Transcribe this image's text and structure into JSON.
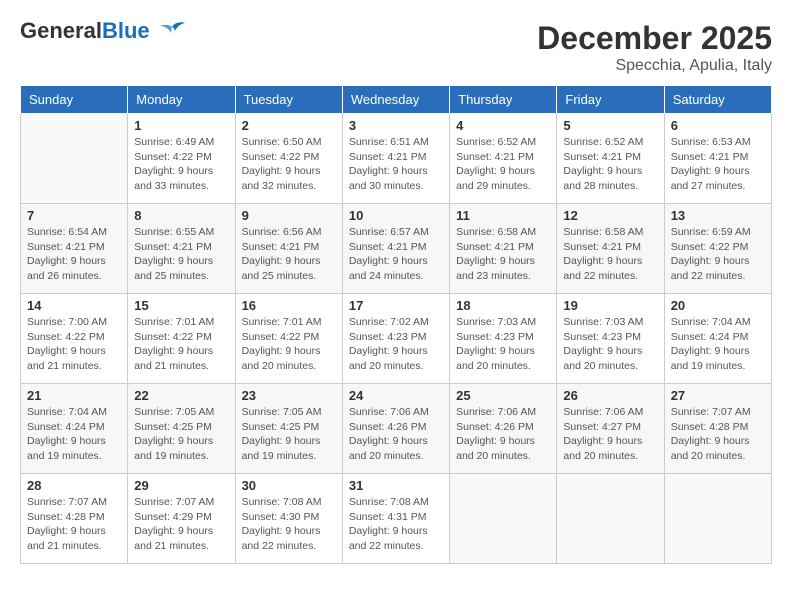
{
  "header": {
    "logo_general": "General",
    "logo_blue": "Blue",
    "month": "December 2025",
    "location": "Specchia, Apulia, Italy"
  },
  "weekdays": [
    "Sunday",
    "Monday",
    "Tuesday",
    "Wednesday",
    "Thursday",
    "Friday",
    "Saturday"
  ],
  "weeks": [
    [
      {
        "day": "",
        "info": ""
      },
      {
        "day": "1",
        "info": "Sunrise: 6:49 AM\nSunset: 4:22 PM\nDaylight: 9 hours\nand 33 minutes."
      },
      {
        "day": "2",
        "info": "Sunrise: 6:50 AM\nSunset: 4:22 PM\nDaylight: 9 hours\nand 32 minutes."
      },
      {
        "day": "3",
        "info": "Sunrise: 6:51 AM\nSunset: 4:21 PM\nDaylight: 9 hours\nand 30 minutes."
      },
      {
        "day": "4",
        "info": "Sunrise: 6:52 AM\nSunset: 4:21 PM\nDaylight: 9 hours\nand 29 minutes."
      },
      {
        "day": "5",
        "info": "Sunrise: 6:52 AM\nSunset: 4:21 PM\nDaylight: 9 hours\nand 28 minutes."
      },
      {
        "day": "6",
        "info": "Sunrise: 6:53 AM\nSunset: 4:21 PM\nDaylight: 9 hours\nand 27 minutes."
      }
    ],
    [
      {
        "day": "7",
        "info": "Sunrise: 6:54 AM\nSunset: 4:21 PM\nDaylight: 9 hours\nand 26 minutes."
      },
      {
        "day": "8",
        "info": "Sunrise: 6:55 AM\nSunset: 4:21 PM\nDaylight: 9 hours\nand 25 minutes."
      },
      {
        "day": "9",
        "info": "Sunrise: 6:56 AM\nSunset: 4:21 PM\nDaylight: 9 hours\nand 25 minutes."
      },
      {
        "day": "10",
        "info": "Sunrise: 6:57 AM\nSunset: 4:21 PM\nDaylight: 9 hours\nand 24 minutes."
      },
      {
        "day": "11",
        "info": "Sunrise: 6:58 AM\nSunset: 4:21 PM\nDaylight: 9 hours\nand 23 minutes."
      },
      {
        "day": "12",
        "info": "Sunrise: 6:58 AM\nSunset: 4:21 PM\nDaylight: 9 hours\nand 22 minutes."
      },
      {
        "day": "13",
        "info": "Sunrise: 6:59 AM\nSunset: 4:22 PM\nDaylight: 9 hours\nand 22 minutes."
      }
    ],
    [
      {
        "day": "14",
        "info": "Sunrise: 7:00 AM\nSunset: 4:22 PM\nDaylight: 9 hours\nand 21 minutes."
      },
      {
        "day": "15",
        "info": "Sunrise: 7:01 AM\nSunset: 4:22 PM\nDaylight: 9 hours\nand 21 minutes."
      },
      {
        "day": "16",
        "info": "Sunrise: 7:01 AM\nSunset: 4:22 PM\nDaylight: 9 hours\nand 20 minutes."
      },
      {
        "day": "17",
        "info": "Sunrise: 7:02 AM\nSunset: 4:23 PM\nDaylight: 9 hours\nand 20 minutes."
      },
      {
        "day": "18",
        "info": "Sunrise: 7:03 AM\nSunset: 4:23 PM\nDaylight: 9 hours\nand 20 minutes."
      },
      {
        "day": "19",
        "info": "Sunrise: 7:03 AM\nSunset: 4:23 PM\nDaylight: 9 hours\nand 20 minutes."
      },
      {
        "day": "20",
        "info": "Sunrise: 7:04 AM\nSunset: 4:24 PM\nDaylight: 9 hours\nand 19 minutes."
      }
    ],
    [
      {
        "day": "21",
        "info": "Sunrise: 7:04 AM\nSunset: 4:24 PM\nDaylight: 9 hours\nand 19 minutes."
      },
      {
        "day": "22",
        "info": "Sunrise: 7:05 AM\nSunset: 4:25 PM\nDaylight: 9 hours\nand 19 minutes."
      },
      {
        "day": "23",
        "info": "Sunrise: 7:05 AM\nSunset: 4:25 PM\nDaylight: 9 hours\nand 19 minutes."
      },
      {
        "day": "24",
        "info": "Sunrise: 7:06 AM\nSunset: 4:26 PM\nDaylight: 9 hours\nand 20 minutes."
      },
      {
        "day": "25",
        "info": "Sunrise: 7:06 AM\nSunset: 4:26 PM\nDaylight: 9 hours\nand 20 minutes."
      },
      {
        "day": "26",
        "info": "Sunrise: 7:06 AM\nSunset: 4:27 PM\nDaylight: 9 hours\nand 20 minutes."
      },
      {
        "day": "27",
        "info": "Sunrise: 7:07 AM\nSunset: 4:28 PM\nDaylight: 9 hours\nand 20 minutes."
      }
    ],
    [
      {
        "day": "28",
        "info": "Sunrise: 7:07 AM\nSunset: 4:28 PM\nDaylight: 9 hours\nand 21 minutes."
      },
      {
        "day": "29",
        "info": "Sunrise: 7:07 AM\nSunset: 4:29 PM\nDaylight: 9 hours\nand 21 minutes."
      },
      {
        "day": "30",
        "info": "Sunrise: 7:08 AM\nSunset: 4:30 PM\nDaylight: 9 hours\nand 22 minutes."
      },
      {
        "day": "31",
        "info": "Sunrise: 7:08 AM\nSunset: 4:31 PM\nDaylight: 9 hours\nand 22 minutes."
      },
      {
        "day": "",
        "info": ""
      },
      {
        "day": "",
        "info": ""
      },
      {
        "day": "",
        "info": ""
      }
    ]
  ]
}
